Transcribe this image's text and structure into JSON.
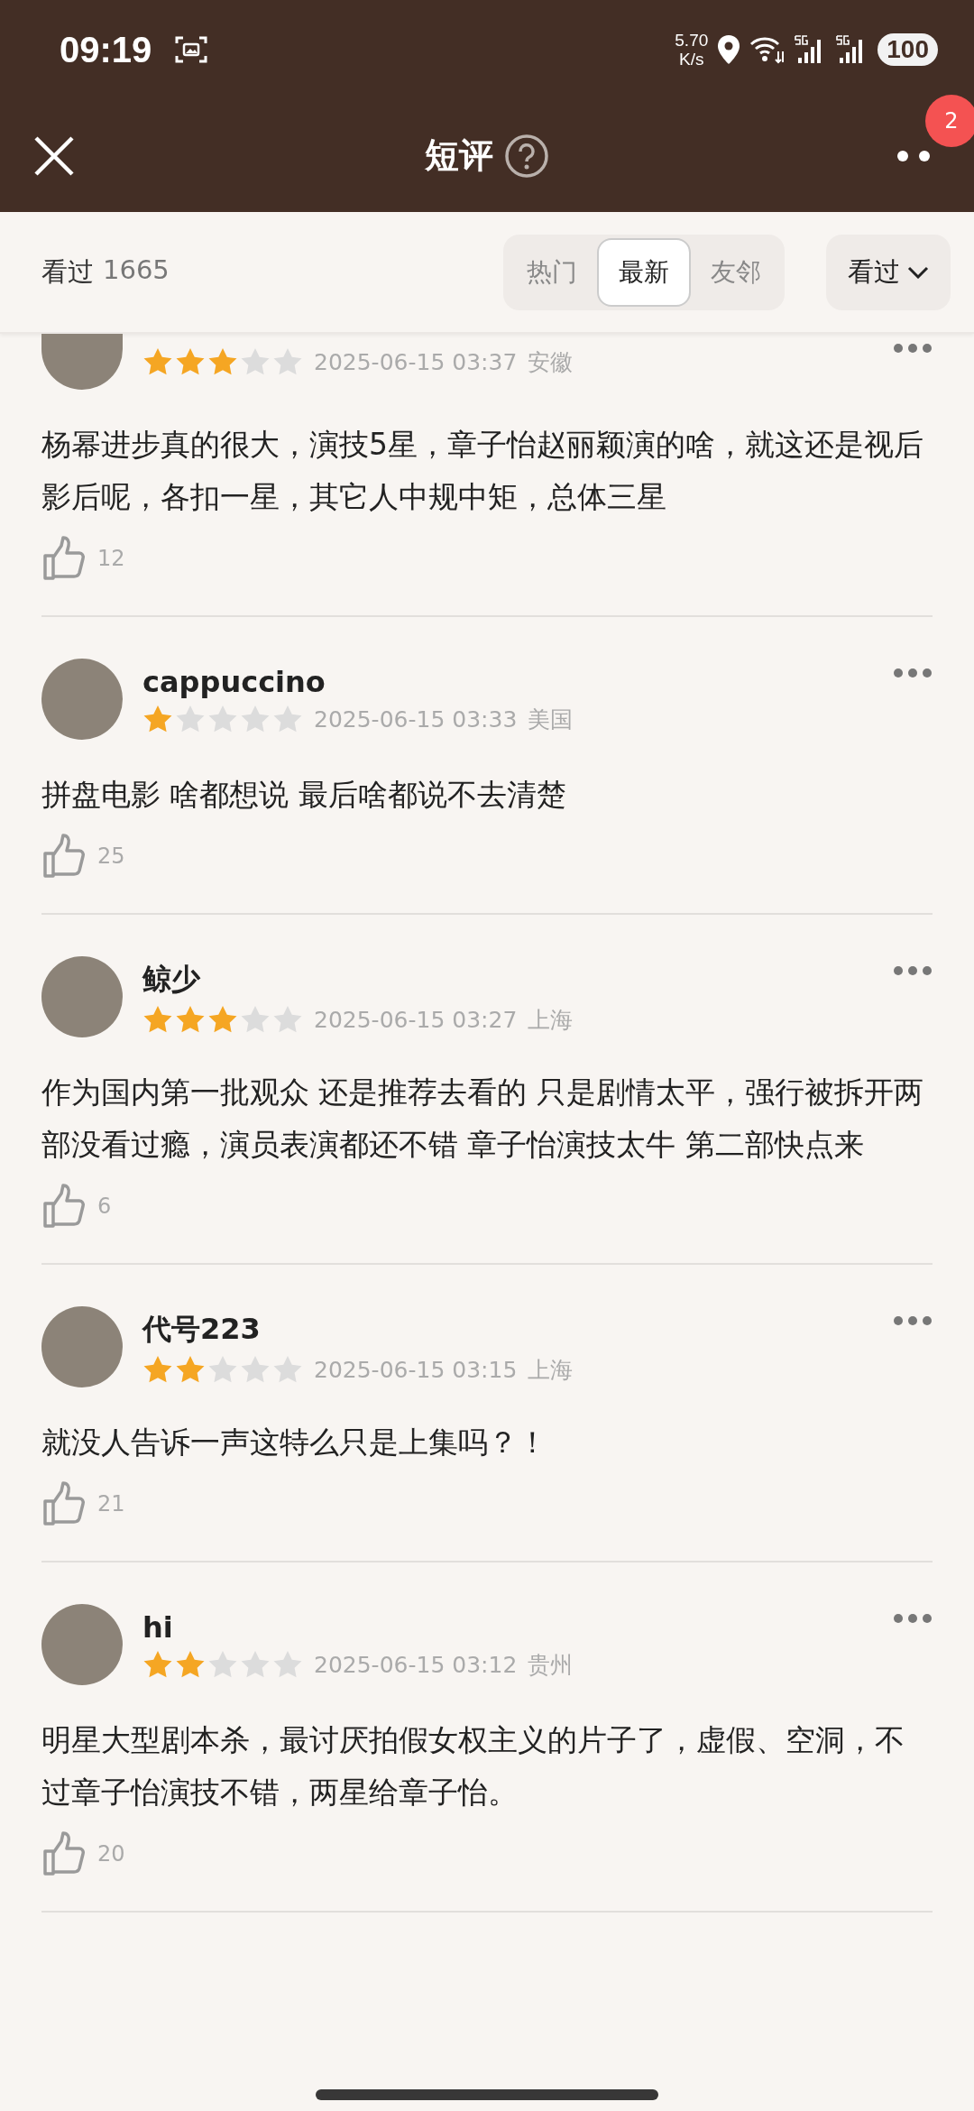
{
  "status_bar": {
    "time": "09:19",
    "speed_value": "5.70",
    "speed_unit": "K/s",
    "battery": "100"
  },
  "header": {
    "title": "短评",
    "badge": "2"
  },
  "filter_bar": {
    "label": "看过",
    "count": "1665",
    "tabs": [
      {
        "label": "热门",
        "selected": false
      },
      {
        "label": "最新",
        "selected": true
      },
      {
        "label": "友邻",
        "selected": false
      }
    ],
    "dropdown": "看过"
  },
  "reviews": [
    {
      "stars": 3,
      "time": "2025-06-15 03:37",
      "location": "安徽",
      "text": "杨幂进步真的很大，演技5星，章子怡赵丽颖演的啥，就这还是视后影后呢，各扣一星，其它人中规中矩，总体三星",
      "likes": "12"
    },
    {
      "name": "cappuccino",
      "stars": 1,
      "time": "2025-06-15 03:33",
      "location": "美国",
      "text": "拼盘电影 啥都想说 最后啥都说不去清楚",
      "likes": "25"
    },
    {
      "name": "鲸少",
      "stars": 3,
      "time": "2025-06-15 03:27",
      "location": "上海",
      "text": "作为国内第一批观众 还是推荐去看的 只是剧情太平，强行被拆开两部没看过瘾，演员表演都还不错 章子怡演技太牛 第二部快点来",
      "likes": "6"
    },
    {
      "name": "代号223",
      "stars": 2,
      "time": "2025-06-15 03:15",
      "location": "上海",
      "text": "就没人告诉一声这特么只是上集吗？！",
      "likes": "21"
    },
    {
      "name": "hi",
      "stars": 2,
      "time": "2025-06-15 03:12",
      "location": "贵州",
      "text": "明星大型剧本杀，最讨厌拍假女权主义的片子了，虚假、空洞，不过章子怡演技不错，两星给章子怡。",
      "likes": "20"
    }
  ]
}
